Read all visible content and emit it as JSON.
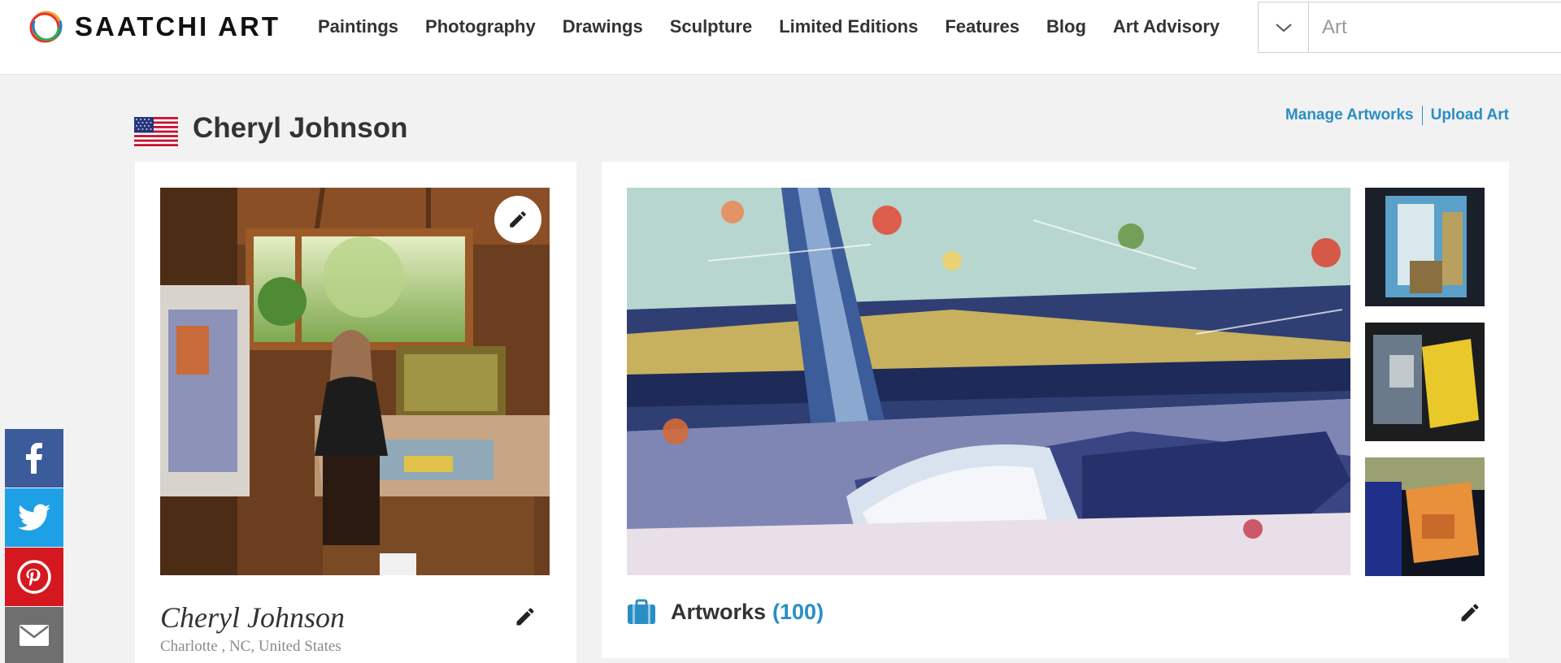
{
  "brand": {
    "name": "SAATCHI ART",
    "logo_icon": "saatchi-rings-logo"
  },
  "nav": {
    "items": [
      {
        "label": "Paintings"
      },
      {
        "label": "Photography"
      },
      {
        "label": "Drawings"
      },
      {
        "label": "Sculpture"
      },
      {
        "label": "Limited Editions"
      },
      {
        "label": "Features"
      },
      {
        "label": "Blog"
      },
      {
        "label": "Art Advisory"
      }
    ]
  },
  "search": {
    "placeholder": "Art",
    "dropdown_icon": "chevron-down-icon"
  },
  "profile": {
    "title": "Cheryl Johnson",
    "country_flag": "us-flag",
    "manage_link": "Manage Artworks",
    "upload_link": "Upload Art",
    "name": "Cheryl Johnson",
    "location": "Charlotte , NC, United States"
  },
  "artworks": {
    "label": "Artworks",
    "count": "(100)",
    "icon": "briefcase-icon"
  },
  "share": {
    "facebook": "facebook-icon",
    "twitter": "twitter-icon",
    "pinterest": "pinterest-icon",
    "email": "email-icon"
  },
  "colors": {
    "accent": "#2a8ec5",
    "facebook": "#3b5b9a",
    "twitter": "#1ea0e6",
    "pinterest": "#d51820",
    "email": "#6f6f6f"
  }
}
